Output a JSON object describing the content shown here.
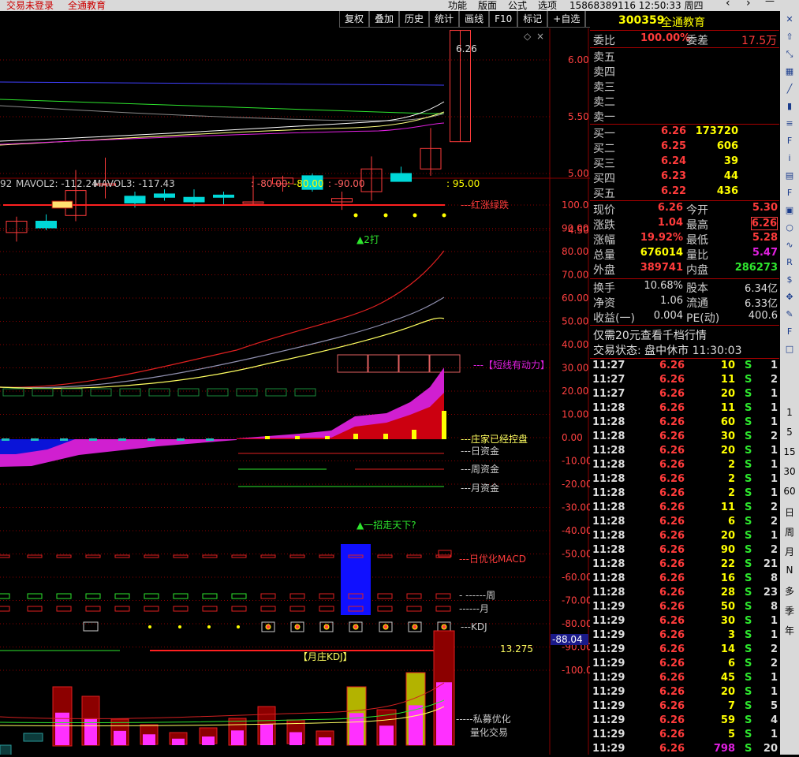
{
  "window": {
    "title_left": "交易未登录",
    "title_stock": "全通教育",
    "menus": [
      "功能",
      "版面",
      "公式",
      "选项"
    ],
    "account_time": "15868389116 12:50:33 周四"
  },
  "toolbar": [
    "复权",
    "叠加",
    "历史",
    "统计",
    "画线",
    "F10",
    "标记",
    "+自选",
    "返回"
  ],
  "colors": {
    "up": "#ff3b3b",
    "down": "#00d8d8",
    "accent": "#ffff00",
    "magenta": "#e020e0",
    "green": "#2ee62e",
    "grid": "#8a0000",
    "bg": "#000000"
  },
  "main_chart": {
    "high_label": "6.26",
    "y_ticks": [
      "6.00",
      "5.50",
      "5.00",
      "4.50"
    ],
    "candles": [
      {
        "o": 4.48,
        "h": 4.62,
        "l": 4.4,
        "c": 4.58
      },
      {
        "o": 4.58,
        "h": 4.64,
        "l": 4.5,
        "c": 4.52
      },
      {
        "o": 4.63,
        "h": 5.03,
        "l": 4.58,
        "c": 4.85
      },
      {
        "o": 4.91,
        "h": 5.14,
        "l": 4.78,
        "c": 4.91
      },
      {
        "o": 4.8,
        "h": 4.84,
        "l": 4.7,
        "c": 4.74
      },
      {
        "o": 4.82,
        "h": 4.86,
        "l": 4.76,
        "c": 4.79
      },
      {
        "o": 4.79,
        "h": 4.86,
        "l": 4.71,
        "c": 4.75
      },
      {
        "o": 4.81,
        "h": 4.84,
        "l": 4.72,
        "c": 4.79
      },
      {
        "o": 4.75,
        "h": 4.98,
        "l": 4.72,
        "c": 4.75
      },
      {
        "o": 4.91,
        "h": 4.98,
        "l": 4.84,
        "c": 4.96
      },
      {
        "o": 4.98,
        "h": 5.0,
        "l": 4.84,
        "c": 4.86
      },
      {
        "o": 4.75,
        "h": 4.84,
        "l": 4.68,
        "c": 4.78
      },
      {
        "o": 4.84,
        "h": 5.15,
        "l": 4.76,
        "c": 5.04
      },
      {
        "o": 5.0,
        "h": 5.06,
        "l": 4.94,
        "c": 4.93
      },
      {
        "o": 5.04,
        "h": 5.4,
        "l": 4.98,
        "c": 5.22
      },
      {
        "o": 5.28,
        "h": 6.26,
        "l": 5.28,
        "c": 6.26
      }
    ]
  },
  "vol_header": {
    "a": "92",
    "mavol2": "MAVOL2: -112.24",
    "mavol3": "MAVOL3: -117.43",
    "v1": ": -80.00",
    "v2": ": -80.00",
    "v3": ": -90.00",
    "v4": ": 95.00"
  },
  "indicator": {
    "y_ticks": [
      "100.0",
      "90.00",
      "80.00",
      "70.00",
      "60.00",
      "50.00",
      "40.00",
      "30.00",
      "20.00",
      "10.00",
      "0.00",
      "-10.00",
      "-20.00",
      "-30.00",
      "-40.00",
      "-50.00",
      "-60.00",
      "-70.00",
      "-80.00",
      "-90.00",
      "-100.0"
    ],
    "labels": {
      "hongzhang": "---红涨绿跌",
      "da": "▲2打",
      "duanxian": "---【短线有动力】",
      "zhuangjia": "---庄家已经控盘",
      "ri": "---日资金",
      "zhou": "---周资金",
      "yue": "---月资金",
      "yizhao": "▲一招走天下?",
      "macd": "---日优化MACD",
      "zhou2": "- ------周",
      "yue2": "------月",
      "kdj": "---KDJ",
      "val1": "13.275",
      "val2": "-88.04",
      "yuezhuang": "【月庄KDJ】",
      "simu": "-----私募优化",
      "lianghua": "量化交易"
    },
    "zhuangjia_bars": [
      2,
      1,
      2,
      1,
      3,
      2,
      3,
      4,
      5,
      6,
      2,
      3,
      6,
      9,
      11,
      31,
      45,
      60,
      65,
      70,
      75,
      80
    ],
    "bottom_bars": [
      0,
      1,
      3,
      2,
      1,
      0,
      2,
      2,
      4,
      1,
      5,
      3,
      6,
      3,
      8,
      10
    ]
  },
  "quote": {
    "code": "300359",
    "name": "全通教育",
    "weibi_label": "委比",
    "weibi": "100.00%",
    "weicha_label": "委差",
    "weicha": "17.5万",
    "sell": [
      {
        "label": "卖五"
      },
      {
        "label": "卖四"
      },
      {
        "label": "卖三"
      },
      {
        "label": "卖二"
      },
      {
        "label": "卖一"
      }
    ],
    "buy": [
      {
        "label": "买一",
        "price": "6.26",
        "vol": "173720"
      },
      {
        "label": "买二",
        "price": "6.25",
        "vol": "606"
      },
      {
        "label": "买三",
        "price": "6.24",
        "vol": "39"
      },
      {
        "label": "买四",
        "price": "6.23",
        "vol": "44"
      },
      {
        "label": "买五",
        "price": "6.22",
        "vol": "436"
      }
    ],
    "stats": [
      {
        "l1": "现价",
        "v1": "6.26",
        "l2": "今开",
        "v2": "5.30",
        "c1": "#ff3b3b",
        "c2": "#ff3b3b"
      },
      {
        "l1": "涨跌",
        "v1": "1.04",
        "l2": "最高",
        "v2": "6.26",
        "c1": "#ff3b3b",
        "c2": "#ff3b3b"
      },
      {
        "l1": "涨幅",
        "v1": "19.92%",
        "l2": "最低",
        "v2": "5.28",
        "c1": "#ff3b3b",
        "c2": "#ff3b3b"
      },
      {
        "l1": "总量",
        "v1": "676014",
        "l2": "量比",
        "v2": "5.47",
        "c1": "#ffff00",
        "c2": "#e020e0"
      },
      {
        "l1": "外盘",
        "v1": "389741",
        "l2": "内盘",
        "v2": "286273",
        "c1": "#ff3b3b",
        "c2": "#2ee62e"
      }
    ],
    "stats2": [
      {
        "l1": "换手",
        "v1": "10.68%",
        "l2": "股本",
        "v2": "6.34亿"
      },
      {
        "l1": "净资",
        "v1": "1.06",
        "l2": "流通",
        "v2": "6.33亿"
      },
      {
        "l1": "收益(一)",
        "v1": "0.004",
        "l2": "PE(动)",
        "v2": "400.6"
      }
    ],
    "promo": "仅需20元查看千档行情",
    "trade_state": "交易状态: 盘中休市 11:30:03",
    "ticks": [
      [
        "11:27",
        "6.26",
        "10",
        "S",
        "1"
      ],
      [
        "11:27",
        "6.26",
        "11",
        "S",
        "2"
      ],
      [
        "11:27",
        "6.26",
        "20",
        "S",
        "1"
      ],
      [
        "11:28",
        "6.26",
        "11",
        "S",
        "1"
      ],
      [
        "11:28",
        "6.26",
        "60",
        "S",
        "1"
      ],
      [
        "11:28",
        "6.26",
        "30",
        "S",
        "2"
      ],
      [
        "11:28",
        "6.26",
        "20",
        "S",
        "1"
      ],
      [
        "11:28",
        "6.26",
        "2",
        "S",
        "1"
      ],
      [
        "11:28",
        "6.26",
        "2",
        "S",
        "1"
      ],
      [
        "11:28",
        "6.26",
        "2",
        "S",
        "1"
      ],
      [
        "11:28",
        "6.26",
        "11",
        "S",
        "2"
      ],
      [
        "11:28",
        "6.26",
        "6",
        "S",
        "2"
      ],
      [
        "11:28",
        "6.26",
        "20",
        "S",
        "1"
      ],
      [
        "11:28",
        "6.26",
        "90",
        "S",
        "2"
      ],
      [
        "11:28",
        "6.26",
        "22",
        "S",
        "21"
      ],
      [
        "11:28",
        "6.26",
        "16",
        "S",
        "8"
      ],
      [
        "11:28",
        "6.26",
        "28",
        "S",
        "23"
      ],
      [
        "11:29",
        "6.26",
        "50",
        "S",
        "8"
      ],
      [
        "11:29",
        "6.26",
        "30",
        "S",
        "1"
      ],
      [
        "11:29",
        "6.26",
        "3",
        "S",
        "1"
      ],
      [
        "11:29",
        "6.26",
        "14",
        "S",
        "2"
      ],
      [
        "11:29",
        "6.26",
        "6",
        "S",
        "2"
      ],
      [
        "11:29",
        "6.26",
        "45",
        "S",
        "1"
      ],
      [
        "11:29",
        "6.26",
        "20",
        "S",
        "1"
      ],
      [
        "11:29",
        "6.26",
        "7",
        "S",
        "5"
      ],
      [
        "11:29",
        "6.26",
        "59",
        "S",
        "4"
      ],
      [
        "11:29",
        "6.26",
        "5",
        "S",
        "1"
      ],
      [
        "11:29",
        "6.26",
        "798",
        "S",
        "20"
      ]
    ]
  },
  "sidebar": {
    "icons": [
      "close-icon",
      "up-arrow-icon",
      "pin-icon",
      "calendar-icon",
      "chart-line-icon",
      "candle-icon",
      "list-icon",
      "f10-icon",
      "info-icon",
      "book-icon",
      "f12-icon",
      "grid-icon",
      "circle-icon",
      "wave-icon",
      "rsi-icon",
      "dollar-icon",
      "move-icon",
      "pencil-icon",
      "f5-icon",
      "window-icon"
    ],
    "periods": [
      "1",
      "5",
      "15",
      "30",
      "60",
      "日",
      "周",
      "月",
      "N",
      "多",
      "季",
      "年"
    ]
  }
}
